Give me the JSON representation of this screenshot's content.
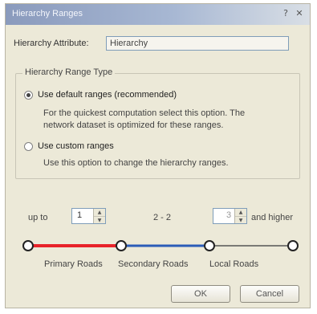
{
  "window": {
    "title": "Hierarchy Ranges",
    "help_label": "?",
    "close_label": "✕"
  },
  "attribute": {
    "label": "Hierarchy Attribute:",
    "value": "Hierarchy"
  },
  "range_type": {
    "legend": "Hierarchy Range Type",
    "default_option": {
      "label": "Use default ranges (recommended)",
      "description_line1": "For the quickest computation select this option.  The",
      "description_line2": "network dataset is optimized for these ranges.",
      "selected": true
    },
    "custom_option": {
      "label": "Use custom ranges",
      "description": "Use this option to change the hierarchy ranges.",
      "selected": false
    }
  },
  "ranges": {
    "up_to_label": "up to",
    "lower_value": "1",
    "middle_label": "2 - 2",
    "upper_value": "3",
    "and_higher_label": "and higher",
    "road_labels": [
      "Primary Roads",
      "Secondary Roads",
      "Local Roads"
    ],
    "colors": {
      "primary": "#e8232a",
      "secondary": "#2b5cb8",
      "local": "#555555"
    }
  },
  "buttons": {
    "ok": "OK",
    "cancel": "Cancel"
  }
}
